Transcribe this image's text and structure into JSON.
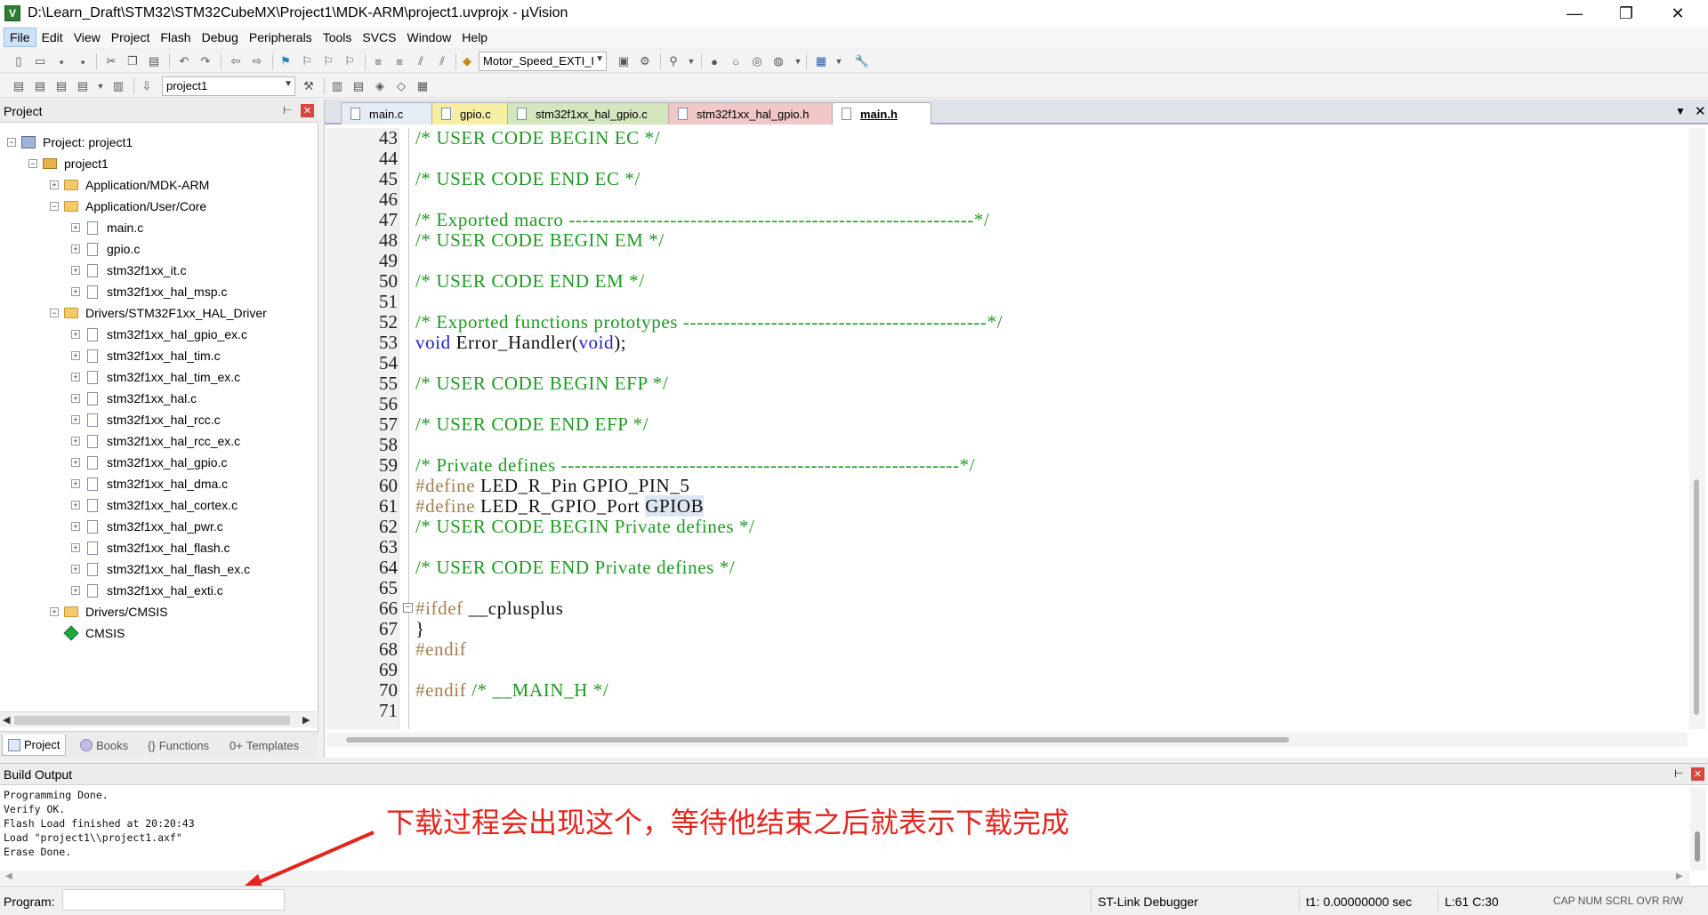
{
  "window": {
    "title": "D:\\Learn_Draft\\STM32\\STM32CubeMX\\Project1\\MDK-ARM\\project1.uvprojx - µVision",
    "app_icon_letter": "V",
    "min_glyph": "—",
    "max_glyph": "❐",
    "close_glyph": "✕"
  },
  "menu": [
    "File",
    "Edit",
    "View",
    "Project",
    "Flash",
    "Debug",
    "Peripherals",
    "Tools",
    "SVCS",
    "Window",
    "Help"
  ],
  "toolbar": {
    "target_combo": "Motor_Speed_EXTI_I",
    "project_combo": "project1"
  },
  "project_panel": {
    "title": "Project",
    "pin_glyph": "📌",
    "close_glyph": "✕",
    "tree": [
      {
        "label": "Project: project1"
      },
      {
        "label": "project1"
      },
      {
        "label": "Application/MDK-ARM"
      },
      {
        "label": "Application/User/Core"
      },
      {
        "label": "main.c"
      },
      {
        "label": "gpio.c"
      },
      {
        "label": "stm32f1xx_it.c"
      },
      {
        "label": "stm32f1xx_hal_msp.c"
      },
      {
        "label": "Drivers/STM32F1xx_HAL_Driver"
      },
      {
        "label": "stm32f1xx_hal_gpio_ex.c"
      },
      {
        "label": "stm32f1xx_hal_tim.c"
      },
      {
        "label": "stm32f1xx_hal_tim_ex.c"
      },
      {
        "label": "stm32f1xx_hal.c"
      },
      {
        "label": "stm32f1xx_hal_rcc.c"
      },
      {
        "label": "stm32f1xx_hal_rcc_ex.c"
      },
      {
        "label": "stm32f1xx_hal_gpio.c"
      },
      {
        "label": "stm32f1xx_hal_dma.c"
      },
      {
        "label": "stm32f1xx_hal_cortex.c"
      },
      {
        "label": "stm32f1xx_hal_pwr.c"
      },
      {
        "label": "stm32f1xx_hal_flash.c"
      },
      {
        "label": "stm32f1xx_hal_flash_ex.c"
      },
      {
        "label": "stm32f1xx_hal_exti.c"
      },
      {
        "label": "Drivers/CMSIS"
      },
      {
        "label": "CMSIS"
      }
    ],
    "tabs": [
      "Project",
      "Books",
      "Functions",
      "Templates"
    ]
  },
  "editor": {
    "tabs": [
      "main.c",
      "gpio.c",
      "stm32f1xx_hal_gpio.c",
      "stm32f1xx_hal_gpio.h",
      "main.h"
    ],
    "active_tab": "main.h",
    "lines": [
      {
        "n": "43",
        "t": "/* USER CODE BEGIN EC */"
      },
      {
        "n": "44",
        "t": ""
      },
      {
        "n": "45",
        "t": "/* USER CODE END EC */"
      },
      {
        "n": "46",
        "t": ""
      },
      {
        "n": "47",
        "t": "/* Exported macro ------------------------------------------------------------*/"
      },
      {
        "n": "48",
        "t": "/* USER CODE BEGIN EM */"
      },
      {
        "n": "49",
        "t": ""
      },
      {
        "n": "50",
        "t": "/* USER CODE END EM */"
      },
      {
        "n": "51",
        "t": ""
      },
      {
        "n": "52",
        "t": "/* Exported functions prototypes ---------------------------------------------*/"
      },
      {
        "n": "53",
        "kw1": "void",
        "mid": " Error_Handler(",
        "kw2": "void",
        "end": ");"
      },
      {
        "n": "54",
        "t": ""
      },
      {
        "n": "55",
        "t": "/* USER CODE BEGIN EFP */"
      },
      {
        "n": "56",
        "t": ""
      },
      {
        "n": "57",
        "t": "/* USER CODE END EFP */"
      },
      {
        "n": "58",
        "t": ""
      },
      {
        "n": "59",
        "t": "/* Private defines -----------------------------------------------------------*/"
      },
      {
        "n": "60",
        "pp": "#define",
        "rest": " LED_R_Pin GPIO_PIN_5"
      },
      {
        "n": "61",
        "pp": "#define",
        "rest": " LED_R_GPIO_Port ",
        "hl": "GPIOB"
      },
      {
        "n": "62",
        "t": "/* USER CODE BEGIN Private defines */"
      },
      {
        "n": "63",
        "t": ""
      },
      {
        "n": "64",
        "t": "/* USER CODE END Private defines */"
      },
      {
        "n": "65",
        "t": ""
      },
      {
        "n": "66",
        "pp": "#ifdef",
        "rest": " __cplusplus"
      },
      {
        "n": "67",
        "plain": "}"
      },
      {
        "n": "68",
        "pp": "#endif",
        "rest": ""
      },
      {
        "n": "69",
        "t": ""
      },
      {
        "n": "70",
        "pp": "#endif",
        "rest": " /* __MAIN_H */",
        "restcom": true
      },
      {
        "n": "71",
        "t": ""
      }
    ]
  },
  "build_output": {
    "title": "Build Output",
    "lines": [
      "Programming Done.",
      "Verify OK.",
      "Flash Load finished at 20:20:43",
      "Load \"project1\\\\project1.axf\"",
      "Erase Done."
    ],
    "annotation": "下载过程会出现这个，等待他结束之后就表示下载完成"
  },
  "statusbar": {
    "program_label": "Program:",
    "debugger": "ST-Link Debugger",
    "time": "t1: 0.00000000 sec",
    "position": "L:61 C:30",
    "caps": "CAP NUM SCRL OVR R/W"
  },
  "colors": {
    "comment": "#1d9b20",
    "keyword": "#2020c8",
    "preprocessor": "#a37f4f",
    "annotation": "#e3261e"
  }
}
